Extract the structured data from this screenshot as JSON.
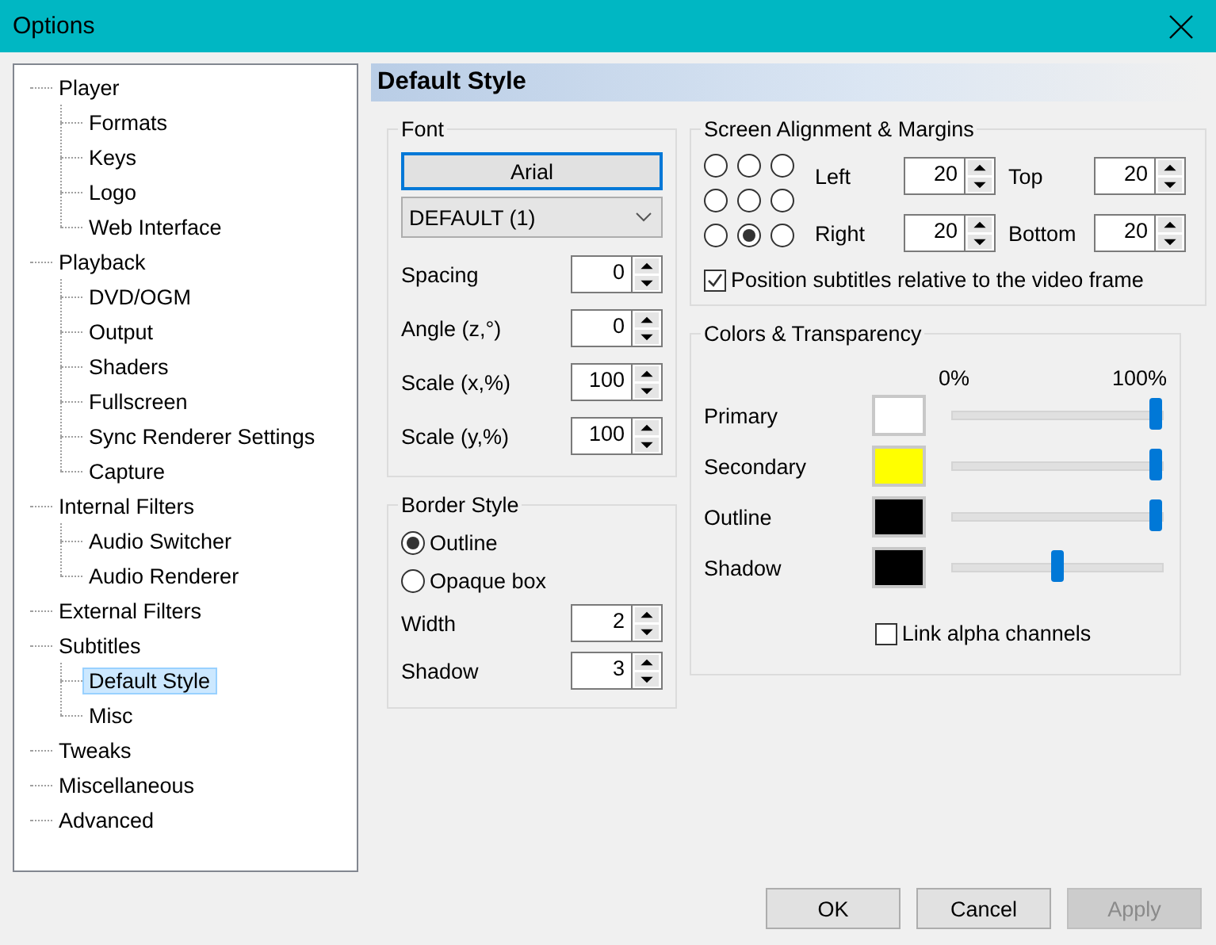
{
  "window": {
    "title": "Options"
  },
  "tree": [
    {
      "label": "Player",
      "selected": false,
      "children": [
        {
          "label": "Formats",
          "selected": false
        },
        {
          "label": "Keys",
          "selected": false
        },
        {
          "label": "Logo",
          "selected": false
        },
        {
          "label": "Web Interface",
          "selected": false
        }
      ]
    },
    {
      "label": "Playback",
      "selected": false,
      "children": [
        {
          "label": "DVD/OGM",
          "selected": false
        },
        {
          "label": "Output",
          "selected": false
        },
        {
          "label": "Shaders",
          "selected": false
        },
        {
          "label": "Fullscreen",
          "selected": false
        },
        {
          "label": "Sync Renderer Settings",
          "selected": false
        },
        {
          "label": "Capture",
          "selected": false
        }
      ]
    },
    {
      "label": "Internal Filters",
      "selected": false,
      "children": [
        {
          "label": "Audio Switcher",
          "selected": false
        },
        {
          "label": "Audio Renderer",
          "selected": false
        }
      ]
    },
    {
      "label": "External Filters",
      "selected": false
    },
    {
      "label": "Subtitles",
      "selected": false,
      "children": [
        {
          "label": "Default Style",
          "selected": true
        },
        {
          "label": "Misc",
          "selected": false
        }
      ]
    },
    {
      "label": "Tweaks",
      "selected": false
    },
    {
      "label": "Miscellaneous",
      "selected": false
    },
    {
      "label": "Advanced",
      "selected": false
    }
  ],
  "page_title": "Default Style",
  "font": {
    "title": "Font",
    "font_button": "Arial",
    "charset": "DEFAULT (1)",
    "fields": [
      {
        "label": "Spacing",
        "value": "0"
      },
      {
        "label": "Angle (z,°)",
        "value": "0"
      },
      {
        "label": "Scale (x,%)",
        "value": "100"
      },
      {
        "label": "Scale (y,%)",
        "value": "100"
      }
    ]
  },
  "border_style": {
    "title": "Border Style",
    "options": [
      {
        "label": "Outline",
        "selected": true
      },
      {
        "label": "Opaque box",
        "selected": false
      }
    ],
    "fields": [
      {
        "label": "Width",
        "value": "2"
      },
      {
        "label": "Shadow",
        "value": "3"
      }
    ]
  },
  "alignment": {
    "title": "Screen Alignment & Margins",
    "positions": [
      {
        "selected": false
      },
      {
        "selected": false
      },
      {
        "selected": false
      },
      {
        "selected": false
      },
      {
        "selected": false
      },
      {
        "selected": false
      },
      {
        "selected": false
      },
      {
        "selected": true
      },
      {
        "selected": false
      }
    ],
    "margins": [
      {
        "label": "Left",
        "value": "20"
      },
      {
        "label": "Top",
        "value": "20"
      },
      {
        "label": "Right",
        "value": "20"
      },
      {
        "label": "Bottom",
        "value": "20"
      }
    ],
    "relative_checkbox": {
      "label": "Position subtitles relative to the video frame",
      "checked": true
    }
  },
  "colors": {
    "title": "Colors & Transparency",
    "min_label": "0%",
    "max_label": "100%",
    "rows": [
      {
        "name": "Primary",
        "color": "#ffffff",
        "level": 1
      },
      {
        "name": "Secondary",
        "color": "#ffff00",
        "level": 1
      },
      {
        "name": "Outline",
        "color": "#000000",
        "level": 1
      },
      {
        "name": "Shadow",
        "color": "#000000",
        "level": 0.5
      }
    ],
    "link_checkbox": {
      "label": "Link alpha channels",
      "checked": false
    }
  },
  "buttons": [
    {
      "label": "OK",
      "disabled": false
    },
    {
      "label": "Cancel",
      "disabled": false
    },
    {
      "label": "Apply",
      "disabled": true
    }
  ]
}
